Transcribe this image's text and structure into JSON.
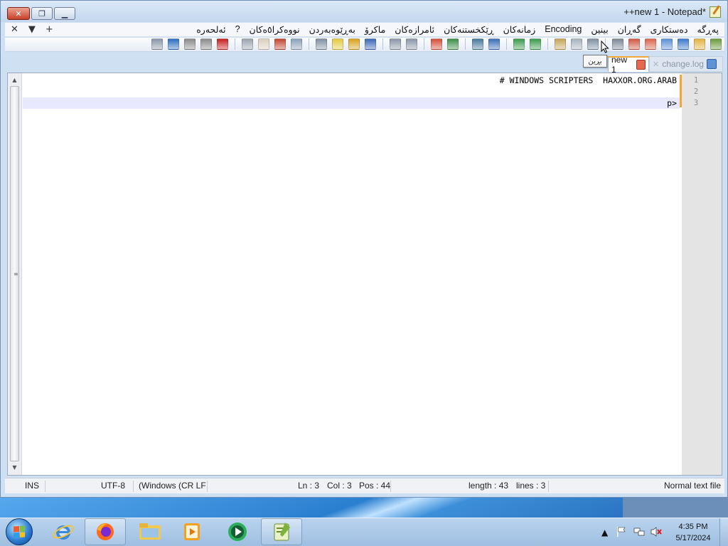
{
  "window": {
    "title": "++new 1 - Notepad*",
    "caption_buttons": {
      "close": "✕",
      "restore": "❐",
      "minimize": "▁"
    }
  },
  "menubar": {
    "left_controls": [
      "✕",
      "▼",
      "+"
    ],
    "items": [
      "پەڕگە",
      "دەستکاری",
      "گەڕان",
      "بینین",
      "Encoding",
      "زمانەکان",
      "ڕێکخستنەکان",
      "ئامرازەکان",
      "ماکرۆ",
      "بەڕێوەبەردن",
      "نووەکرا٥ەکان",
      "?",
      "ئەلحەرە"
    ]
  },
  "toolbar": {
    "tooltip": "بڕین",
    "icons": [
      "new-icon",
      "open-icon",
      "save-icon",
      "save-all-icon",
      "close-icon",
      "close-all-icon",
      "print-icon",
      "cut-icon",
      "copy-icon",
      "paste-icon",
      "undo-icon",
      "redo-icon",
      "find-icon",
      "replace-icon",
      "zoom-in-icon",
      "zoom-out-icon",
      "sync-v-icon",
      "sync-h-icon",
      "word-wrap-icon",
      "all-chars-icon",
      "indent-guide-icon",
      "udl-icon",
      "doc-map-icon",
      "func-list-icon",
      "folder-as-ws-icon",
      "monitor-icon",
      "record-icon",
      "stop-icon",
      "play-icon",
      "play-multi-icon",
      "save-macro-icon"
    ],
    "icon_colors": [
      "#6a9a3c",
      "#e3b341",
      "#3b79c9",
      "#5b8fd6",
      "#d9654d",
      "#cf5a45",
      "#7b8796",
      "#7f8fa3",
      "#a6b2c0",
      "#c6a55a",
      "#3c9b4e",
      "#3c9b4e",
      "#3a6fb8",
      "#47799e",
      "#3b8e46",
      "#d24f38",
      "#8a97a8",
      "#8a97a8",
      "#3a67b8",
      "#d8a21d",
      "#e4c93f",
      "#7f8fa3",
      "#8aa0ba",
      "#c1462f",
      "#d9d0bf",
      "#9aa4b1",
      "#c61f1f",
      "#8a8a8a",
      "#8a8a8a",
      "#2b6fc0",
      "#8a97a8"
    ]
  },
  "tabs": [
    {
      "label": "new 1",
      "active": true,
      "icon": "save-red-icon"
    },
    {
      "label": "change.log",
      "active": false,
      "icon": "save-blue-icon"
    }
  ],
  "editor": {
    "lines": [
      "# WINDOWS SCRIPTERS  HAXXOR.ORG.ARAB",
      "",
      "p>"
    ],
    "line_numbers": [
      "1",
      "2",
      "3"
    ],
    "current_line": 3
  },
  "statusbar": {
    "file_type": "Normal text file",
    "length": "length : 43",
    "lines": "lines : 3",
    "ln": "Ln : 3",
    "col": "Col : 3",
    "pos": "Pos : 44",
    "eol": "(Windows (CR LF",
    "encoding": "UTF-8",
    "mode": "INS"
  },
  "taskbar": {
    "apps": [
      "internet-explorer-icon",
      "firefox-icon",
      "file-explorer-icon",
      "media-player-icon",
      "media-center-icon",
      "notepad-plus-plus-icon"
    ],
    "clock_time": "4:35 PM",
    "clock_date": "5/17/2024",
    "tray_icons": [
      "show-hidden-icons-arrow",
      "action-center-flag-icon",
      "network-icon",
      "volume-muted-icon"
    ]
  },
  "colors": {
    "accent_orange": "#f2a73b",
    "current_line_bg": "#e8e8ff",
    "taskbar_blue": "#2b78c7"
  }
}
